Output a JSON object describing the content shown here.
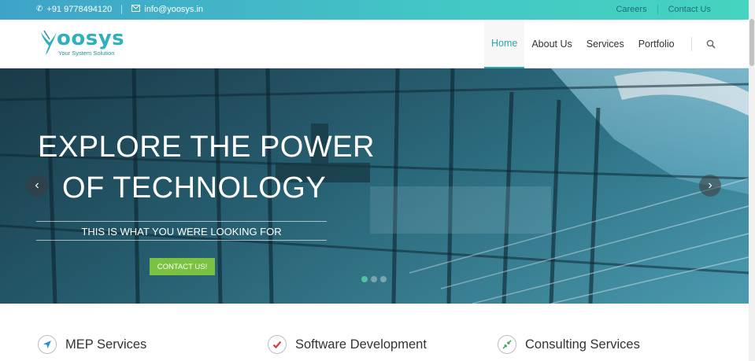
{
  "topbar": {
    "phone": "+91 9778494120",
    "email": "info@yoosys.in",
    "links": [
      "Careers",
      "Contact Us"
    ]
  },
  "logo": {
    "wordmark": "oosys",
    "tagline": "Your System Solution"
  },
  "nav": {
    "items": [
      "Home",
      "About Us",
      "Services",
      "Portfolio"
    ],
    "active": "Home"
  },
  "hero": {
    "title_line1": "EXPLORE THE POWER",
    "title_line2": "OF TECHNOLOGY",
    "subtitle": "THIS IS WHAT YOU WERE LOOKING FOR",
    "cta_label": "CONTACT US!",
    "slide_count": 3,
    "active_slide": 1
  },
  "services": [
    {
      "label": "MEP Services",
      "icon": "navigation-arrow-icon",
      "color": "#2a8fd0"
    },
    {
      "label": "Software Development",
      "icon": "checkmark-icon",
      "color": "#d83b3b"
    },
    {
      "label": "Consulting Services",
      "icon": "arrows-inward-icon",
      "color": "#3aa55a"
    }
  ],
  "colors": {
    "accent": "#2aa6b0",
    "cta": "#7cc242",
    "topbar_start": "#3fa3c9",
    "topbar_end": "#45d4c0"
  }
}
